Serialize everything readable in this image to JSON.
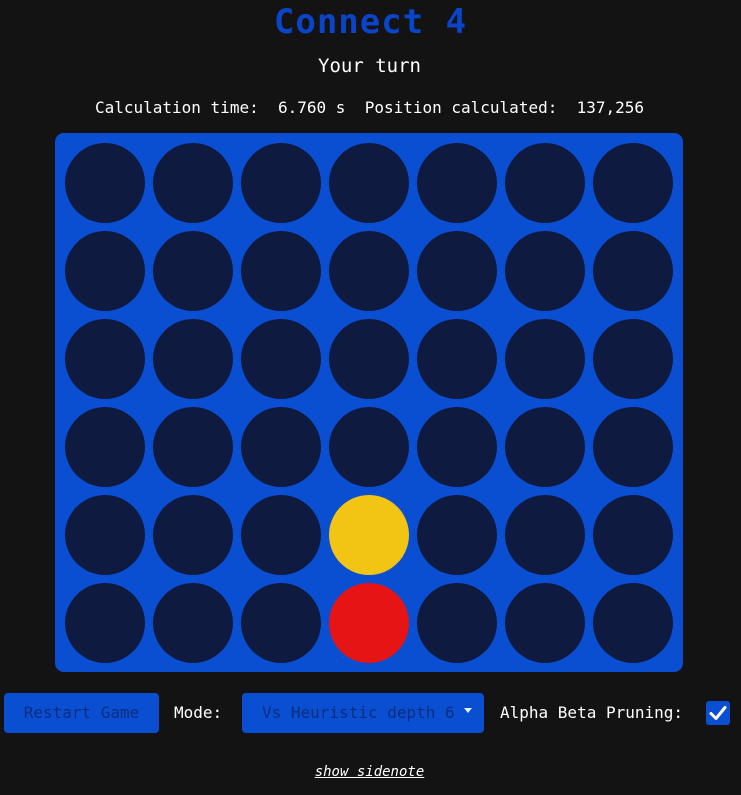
{
  "title": "Connect 4",
  "status": "Your turn",
  "stats": {
    "time_label": "Calculation time:",
    "time_value": "6.760 s",
    "positions_label": "Position calculated:",
    "positions_value": "137,256"
  },
  "board": {
    "rows": 6,
    "cols": 7,
    "grid": [
      [
        "empty",
        "empty",
        "empty",
        "empty",
        "empty",
        "empty",
        "empty"
      ],
      [
        "empty",
        "empty",
        "empty",
        "empty",
        "empty",
        "empty",
        "empty"
      ],
      [
        "empty",
        "empty",
        "empty",
        "empty",
        "empty",
        "empty",
        "empty"
      ],
      [
        "empty",
        "empty",
        "empty",
        "empty",
        "empty",
        "empty",
        "empty"
      ],
      [
        "empty",
        "empty",
        "empty",
        "yellow",
        "empty",
        "empty",
        "empty"
      ],
      [
        "empty",
        "empty",
        "empty",
        "red",
        "empty",
        "empty",
        "empty"
      ]
    ],
    "colors": {
      "board": "#0a4fd1",
      "empty": "#0e1a40",
      "yellow": "#f2c414",
      "red": "#e61414"
    }
  },
  "controls": {
    "restart_label": "Restart Game",
    "mode_label": "Mode:",
    "mode_selected": "Vs Heuristic depth 6",
    "alpha_beta_label": "Alpha Beta Pruning:",
    "alpha_beta_checked": true,
    "checkbox_icon": "checkmark-icon"
  },
  "sidenote_link": "show sidenote"
}
